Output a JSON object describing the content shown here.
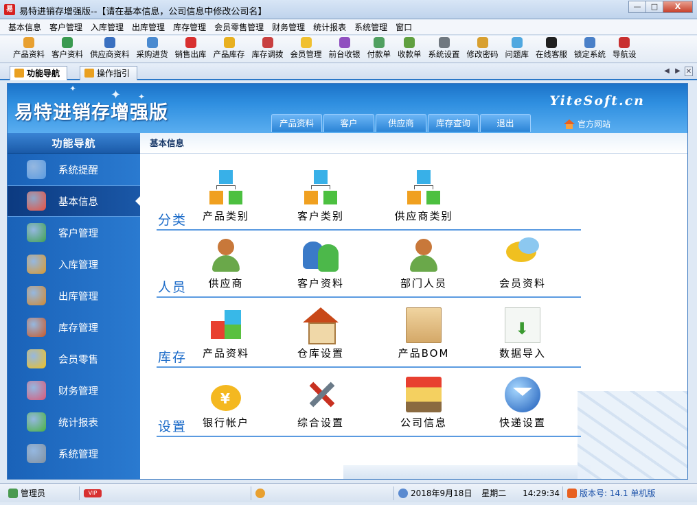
{
  "window": {
    "app_icon_text": "易",
    "title": "易特进销存增强版--【请在基本信息，公司信息中修改公司名】",
    "controls": {
      "minimize": "—",
      "maximize": "□",
      "close": "X"
    }
  },
  "menubar": [
    "基本信息",
    "客户管理",
    "入库管理",
    "出库管理",
    "库存管理",
    "会员零售管理",
    "财务管理",
    "统计报表",
    "系统管理",
    "窗口"
  ],
  "toolbar": [
    {
      "label": "产品资料",
      "icon": "product-icon",
      "color": "#e8a030"
    },
    {
      "label": "客户资料",
      "icon": "customer-icon",
      "color": "#3a9a50"
    },
    {
      "label": "供应商资料",
      "icon": "supplier-icon",
      "color": "#3a70c0"
    },
    {
      "label": "采购进货",
      "icon": "truck-icon",
      "color": "#4a8ad0"
    },
    {
      "label": "销售出库",
      "icon": "cart-icon",
      "color": "#d83030"
    },
    {
      "label": "产品库存",
      "icon": "stock-icon",
      "color": "#e8b020"
    },
    {
      "label": "库存调拨",
      "icon": "transfer-icon",
      "color": "#c84040"
    },
    {
      "label": "会员管理",
      "icon": "member-icon",
      "color": "#f0c030"
    },
    {
      "label": "前台收银",
      "icon": "cashier-icon",
      "color": "#9050c0"
    },
    {
      "label": "付款单",
      "icon": "payment-icon",
      "color": "#50a060"
    },
    {
      "label": "收款单",
      "icon": "receipt-icon",
      "color": "#60a040"
    },
    {
      "label": "系统设置",
      "icon": "settings-icon",
      "color": "#707880"
    },
    {
      "label": "修改密码",
      "icon": "key-icon",
      "color": "#d8a030"
    },
    {
      "label": "问题库",
      "icon": "faq-icon",
      "color": "#50a8e0"
    },
    {
      "label": "在线客服",
      "icon": "qq-icon",
      "color": "#202020"
    },
    {
      "label": "锁定系统",
      "icon": "lock-icon",
      "color": "#4a80c8"
    },
    {
      "label": "导航设",
      "icon": "nav-icon",
      "color": "#c83030"
    }
  ],
  "tabs": [
    {
      "label": "功能导航",
      "active": true
    },
    {
      "label": "操作指引",
      "active": false
    }
  ],
  "tab_nav": {
    "prev": "◀",
    "next": "▶",
    "close": "✕"
  },
  "banner": {
    "title": "易特进销存增强版",
    "site_logo": "YiteSoft.cn",
    "top_tabs": [
      "产品资料",
      "客户",
      "供应商",
      "库存查询",
      "退出"
    ],
    "official_site": "官方网站"
  },
  "sidebar": {
    "heading": "功能导航",
    "items": [
      {
        "label": "系统提醒",
        "icon": "info-icon",
        "color": "#5a9ae0",
        "active": false
      },
      {
        "label": "基本信息",
        "icon": "cubes-icon",
        "color": "#e85040",
        "active": true
      },
      {
        "label": "客户管理",
        "icon": "users-icon",
        "color": "#40a050",
        "active": false
      },
      {
        "label": "入库管理",
        "icon": "box-in-icon",
        "color": "#d89830",
        "active": false
      },
      {
        "label": "出库管理",
        "icon": "box-out-icon",
        "color": "#d08830",
        "active": false
      },
      {
        "label": "库存管理",
        "icon": "house-icon",
        "color": "#c85828",
        "active": false
      },
      {
        "label": "会员零售",
        "icon": "chat-icon",
        "color": "#f0c020",
        "active": false
      },
      {
        "label": "财务管理",
        "icon": "finance-icon",
        "color": "#d85878",
        "active": false
      },
      {
        "label": "统计报表",
        "icon": "chart-icon",
        "color": "#4ab040",
        "active": false
      },
      {
        "label": "系统管理",
        "icon": "tools-icon",
        "color": "#8090a0",
        "active": false
      }
    ]
  },
  "content": {
    "heading": "基本信息",
    "sections": [
      {
        "label": "分类",
        "items": [
          {
            "label": "产品类别",
            "icon": "category-tree-icon"
          },
          {
            "label": "客户类别",
            "icon": "customer-tree-icon"
          },
          {
            "label": "供应商类别",
            "icon": "supplier-tree-icon"
          }
        ]
      },
      {
        "label": "人员",
        "items": [
          {
            "label": "供应商",
            "icon": "supplier-person-icon"
          },
          {
            "label": "客户资料",
            "icon": "customers-icon"
          },
          {
            "label": "部门人员",
            "icon": "staff-icon"
          },
          {
            "label": "会员资料",
            "icon": "member-chat-icon"
          }
        ]
      },
      {
        "label": "库存",
        "items": [
          {
            "label": "产品资料",
            "icon": "product-cubes-icon"
          },
          {
            "label": "仓库设置",
            "icon": "warehouse-house-icon"
          },
          {
            "label": "产品BOM",
            "icon": "bom-box-icon"
          },
          {
            "label": "数据导入",
            "icon": "import-doc-icon"
          }
        ]
      },
      {
        "label": "设置",
        "items": [
          {
            "label": "银行帐户",
            "icon": "money-bag-icon"
          },
          {
            "label": "综合设置",
            "icon": "tools-icon"
          },
          {
            "label": "公司信息",
            "icon": "shop-icon"
          },
          {
            "label": "快递设置",
            "icon": "globe-mail-icon"
          }
        ]
      }
    ]
  },
  "statusbar": {
    "user": "管理员",
    "vip": "VIP",
    "date": "2018年9月18日",
    "weekday": "星期二",
    "time": "14:29:34",
    "version": "版本号: 14.1 单机版"
  }
}
